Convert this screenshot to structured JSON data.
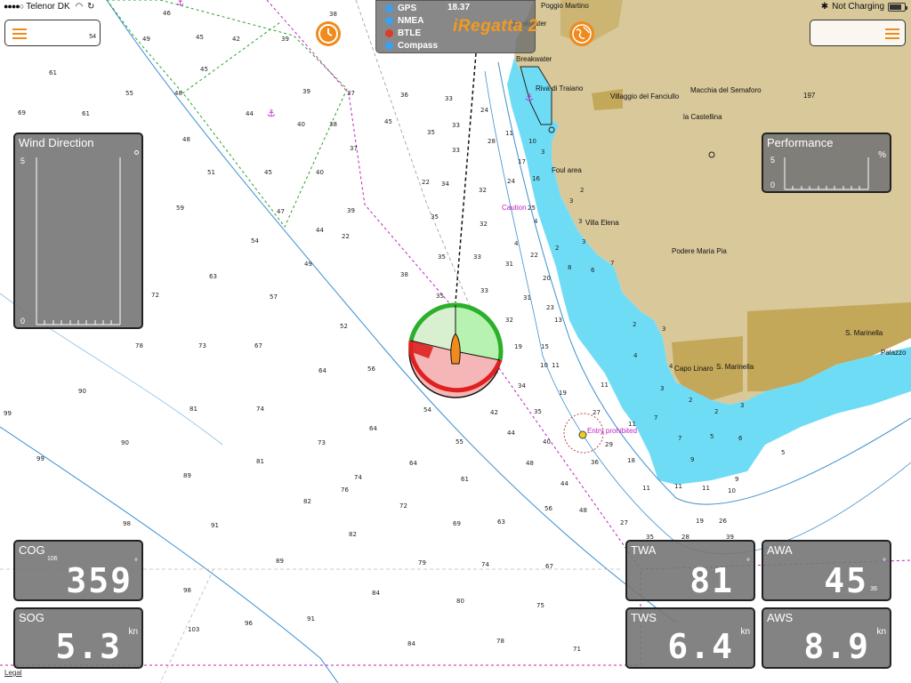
{
  "status_bar": {
    "carrier": "Telenor DK",
    "charging": "Not Charging",
    "battery_level": 0.8
  },
  "menus": {
    "left_value": "54"
  },
  "status_panel": {
    "items": [
      {
        "label": "GPS",
        "color": "#3aa0f0"
      },
      {
        "label": "NMEA",
        "color": "#3aa0f0"
      },
      {
        "label": "BTLE",
        "color": "#e03a2a"
      },
      {
        "label": "Compass",
        "color": "#3aa0f0"
      }
    ],
    "time": "18.37",
    "app_name": "iRegatta 2"
  },
  "wind_direction": {
    "title": "Wind Direction",
    "top_value": "5",
    "bottom_value": "0"
  },
  "performance": {
    "title": "Performance",
    "top_value": "5",
    "bottom_value": "0",
    "unit": "%"
  },
  "instruments": {
    "cog": {
      "label": "COG",
      "value": "359",
      "unit": "°",
      "sub": "106"
    },
    "sog": {
      "label": "SOG",
      "value": "5.3",
      "unit": "kn"
    },
    "twa": {
      "label": "TWA",
      "value": "81",
      "unit": "°"
    },
    "awa": {
      "label": "AWA",
      "value": "45",
      "unit": "°",
      "sub": "36"
    },
    "tws": {
      "label": "TWS",
      "value": "6.4",
      "unit": "kn"
    },
    "aws": {
      "label": "AWS",
      "value": "8.9",
      "unit": "kn"
    }
  },
  "map_labels": {
    "poggio_martino": "Poggio Martino",
    "breakwater_top": "Breakwater",
    "breakwater": "Breakwater",
    "riva_di_traiano": "Riva di Traiano",
    "villaggio": "Villaggio del Fanciullo",
    "macchia": "Macchia del Semaforo",
    "castellina": "la Castellina",
    "foul_area": "Foul area",
    "caution": "Caution",
    "villa_elena": "Villa Elena",
    "podere": "Podere Maria Pia",
    "capo_linaro": "Capo Linaro",
    "s_marinella_1": "S. Marinella",
    "s_marinella_2": "S. Marinella",
    "palazzo": "Palazzo",
    "entry_prohibited": "Entry prohibited",
    "height_197": "197"
  },
  "legal": "Legal",
  "colors": {
    "land": "#d8c89a",
    "land_dark": "#c4a85a",
    "shallow": "#6fdcf6",
    "accent": "#f08a1c",
    "magenta": "#c020c0"
  }
}
